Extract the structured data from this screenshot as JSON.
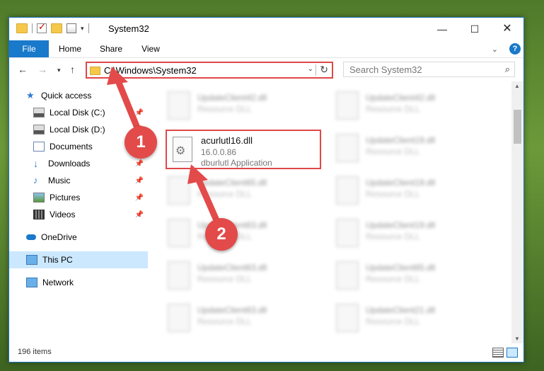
{
  "window": {
    "title": "System32",
    "controls": {
      "minimize": "—",
      "maximize": "☐",
      "close": "✕"
    }
  },
  "ribbon": {
    "tabs": [
      "File",
      "Home",
      "Share",
      "View"
    ],
    "expand_icon": "chevron-down-icon",
    "help": "?"
  },
  "nav": {
    "address": "C:\\Windows\\System32",
    "search_placeholder": "Search System32"
  },
  "sidebar": {
    "items": [
      {
        "label": "Quick access",
        "icon": "star-icon"
      },
      {
        "label": "Local Disk (C:)",
        "icon": "drive-icon",
        "pinned": true
      },
      {
        "label": "Local Disk (D:)",
        "icon": "drive-icon",
        "pinned": true
      },
      {
        "label": "Documents",
        "icon": "documents-icon",
        "pinned": true
      },
      {
        "label": "Downloads",
        "icon": "downloads-icon",
        "pinned": true
      },
      {
        "label": "Music",
        "icon": "music-icon",
        "pinned": true
      },
      {
        "label": "Pictures",
        "icon": "pictures-icon",
        "pinned": true
      },
      {
        "label": "Videos",
        "icon": "videos-icon",
        "pinned": true
      },
      {
        "label": "OneDrive",
        "icon": "cloud-icon"
      },
      {
        "label": "This PC",
        "icon": "computer-icon",
        "selected": true
      },
      {
        "label": "Network",
        "icon": "network-icon"
      }
    ]
  },
  "files": {
    "highlighted": {
      "name": "acurlutl16.dll",
      "version": "16.0.0.86",
      "description": "dburlutl Application"
    },
    "left_column": [
      {
        "name": "UpdateClient42.dll",
        "desc": "Resource DLL"
      },
      {
        "name": "UpdateClient65.dll",
        "desc": "Resource DLL"
      },
      {
        "name": "UpdateClient63.dll",
        "desc": "Resource DLL"
      },
      {
        "name": "UpdateClient63.dll",
        "desc": "Resource DLL"
      },
      {
        "name": "UpdateClient63.dll",
        "desc": "Resource DLL"
      }
    ],
    "right_column": [
      {
        "name": "UpdateClient42.dll",
        "desc": "Resource DLL"
      },
      {
        "name": "UpdateClient19.dll",
        "desc": "Resource DLL"
      },
      {
        "name": "UpdateClient19.dll",
        "desc": "Resource DLL"
      },
      {
        "name": "UpdateClient19.dll",
        "desc": "Resource DLL"
      },
      {
        "name": "UpdateClient65.dll",
        "desc": "Resource DLL"
      },
      {
        "name": "UpdateClient21.dll",
        "desc": "Resource DLL"
      }
    ]
  },
  "status": {
    "item_count": "196 items"
  },
  "markers": [
    "1",
    "2"
  ],
  "colors": {
    "accent": "#1979ca",
    "highlight": "#e04848",
    "selection": "#cce8ff"
  }
}
